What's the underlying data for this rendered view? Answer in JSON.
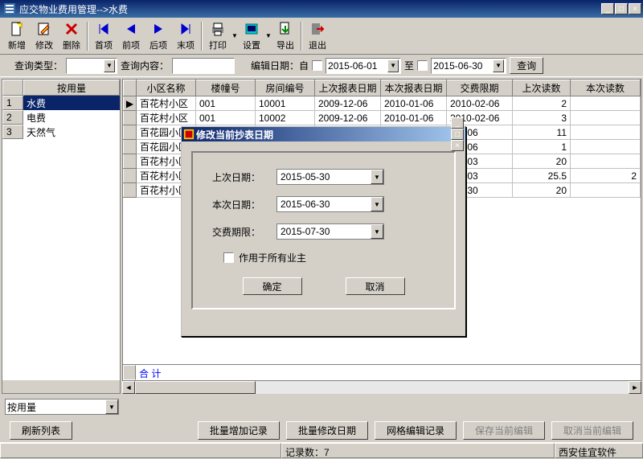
{
  "window": {
    "title": "应交物业费用管理-->水费"
  },
  "toolbar": {
    "new": "新增",
    "edit": "修改",
    "delete": "删除",
    "first": "首项",
    "prev": "前项",
    "next": "后项",
    "last": "末项",
    "print": "打印",
    "settings": "设置",
    "export": "导出",
    "exit": "退出"
  },
  "search": {
    "type_label": "查询类型：",
    "content_label": "查询内容：",
    "edit_date_label": "编辑日期：自",
    "to_label": "至",
    "date_from": "2015-06-01",
    "date_to": "2015-06-30",
    "query_btn": "查询"
  },
  "side": {
    "header": "按用量",
    "items": [
      "水费",
      "电费",
      "天然气"
    ],
    "selected": 0
  },
  "grid": {
    "columns": [
      "小区名称",
      "楼幢号",
      "房间编号",
      "上次报表日期",
      "本次报表日期",
      "交费限期",
      "上次读数",
      "本次读数"
    ],
    "rows": [
      {
        "community": "百花村小区",
        "building": "001",
        "room": "10001",
        "last_date": "2009-12-06",
        "this_date": "2010-01-06",
        "due": "2010-02-06",
        "last_read": 2,
        "this_read": ""
      },
      {
        "community": "百花村小区",
        "building": "001",
        "room": "10002",
        "last_date": "2009-12-06",
        "this_date": "2010-01-06",
        "due": "2010-02-06",
        "last_read": 3,
        "this_read": ""
      },
      {
        "community": "百花园小区",
        "building": "",
        "room": "",
        "last_date": "",
        "this_date": "",
        "due": "-02-06",
        "last_read": 11,
        "this_read": ""
      },
      {
        "community": "百花园小区",
        "building": "",
        "room": "",
        "last_date": "",
        "this_date": "",
        "due": "-02-06",
        "last_read": 1,
        "this_read": ""
      },
      {
        "community": "百花村小区",
        "building": "",
        "room": "",
        "last_date": "",
        "this_date": "",
        "due": "-12-03",
        "last_read": 20,
        "this_read": ""
      },
      {
        "community": "百花村小区",
        "building": "",
        "room": "",
        "last_date": "",
        "this_date": "",
        "due": "-12-03",
        "last_read": 25.5,
        "this_read": 2
      },
      {
        "community": "百花村小区",
        "building": "",
        "room": "",
        "last_date": "",
        "this_date": "",
        "due": "-06-30",
        "last_read": 20,
        "this_read": ""
      }
    ],
    "footer_label": "合  计"
  },
  "bottom": {
    "combo": "按用量",
    "refresh": "刷新列表",
    "batch_add": "批量增加记录",
    "batch_date": "批量修改日期",
    "net_edit": "网格编辑记录",
    "save_edit": "保存当前编辑",
    "cancel_edit": "取消当前编辑"
  },
  "status": {
    "records": "记录数：7",
    "company": "西安佳宜软件"
  },
  "modal": {
    "title": "修改当前抄表日期",
    "last_label": "上次日期：",
    "last_val": "2015-05-30",
    "this_label": "本次日期：",
    "this_val": "2015-06-30",
    "due_label": "交费期限：",
    "due_val": "2015-07-30",
    "apply_all": "作用于所有业主",
    "ok": "确定",
    "cancel": "取消"
  }
}
